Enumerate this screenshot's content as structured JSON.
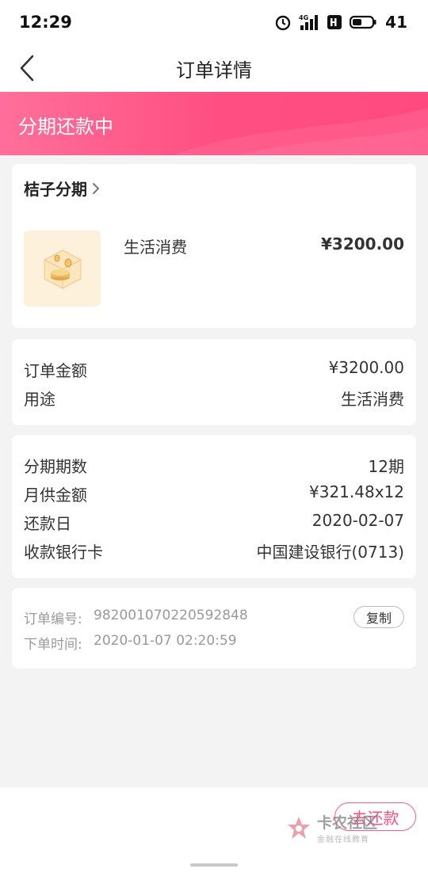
{
  "status_bar": {
    "time": "12:29",
    "network": "4G",
    "battery_level": "41"
  },
  "nav": {
    "title": "订单详情"
  },
  "banner": {
    "status": "分期还款中"
  },
  "product": {
    "merchant": "桔子分期",
    "name": "生活消费",
    "price": "¥3200.00"
  },
  "order_info": [
    {
      "label": "订单金额",
      "value": "¥3200.00"
    },
    {
      "label": "用途",
      "value": "生活消费"
    }
  ],
  "plan_info": [
    {
      "label": "分期期数",
      "value": "12期"
    },
    {
      "label": "月供金额",
      "value": "¥321.48x12"
    },
    {
      "label": "还款日",
      "value": "2020-02-07"
    },
    {
      "label": "收款银行卡",
      "value": "中国建设银行(0713)"
    }
  ],
  "meta": {
    "order_no_label": "订单编号:",
    "order_no": "982001070220592848",
    "order_time_label": "下单时间:",
    "order_time": "2020-01-07 02:20:59",
    "copy_label": "复制"
  },
  "bottom": {
    "repay_label": "去还款"
  },
  "watermark": {
    "title": "卡农社区",
    "subtitle": "金融在线教育"
  },
  "colors": {
    "accent": "#ff4a80",
    "banner_start": "#ff6f9a",
    "page_bg": "#f3f3f3"
  }
}
